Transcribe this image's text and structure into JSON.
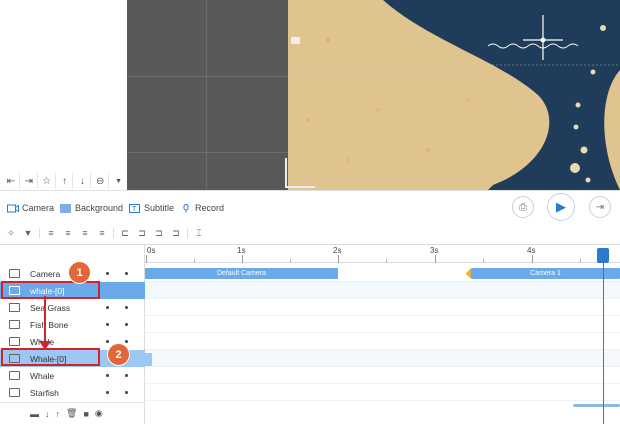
{
  "canvas_toolbar": {
    "icons": [
      "exit-icon",
      "enter-icon",
      "star-icon",
      "arrow-up-icon",
      "arrow-down-icon",
      "minus-circle-icon",
      "dropdown-arrow-icon"
    ]
  },
  "tabs": {
    "camera": "Camera",
    "background": "Background",
    "subtitle": "Subtitle",
    "record": "Record"
  },
  "ruler": {
    "labels": [
      "0s",
      "1s",
      "2s",
      "3s",
      "4s"
    ]
  },
  "layers": [
    {
      "name": "Camera",
      "type": "camera"
    },
    {
      "name": "whale-[0]",
      "type": "image",
      "selected": true
    },
    {
      "name": "Sea Grass",
      "type": "image"
    },
    {
      "name": "Fish Bone",
      "type": "image"
    },
    {
      "name": "Whale",
      "type": "image"
    },
    {
      "name": "Whale-[0]",
      "type": "image",
      "dragging": true
    },
    {
      "name": "Whale",
      "type": "image"
    },
    {
      "name": "Starfish",
      "type": "image"
    }
  ],
  "clips": {
    "default_camera": "Default Camera",
    "camera_1": "Camera 1"
  },
  "annotations": {
    "step1": "1",
    "step2": "2"
  },
  "colors": {
    "accent": "#2a7ad2",
    "selection": "#6aa9ea",
    "highlight": "#d2232a",
    "badge": "#e3663b",
    "ocean": "#1f3d5a",
    "parchment": "#e0c48f"
  }
}
